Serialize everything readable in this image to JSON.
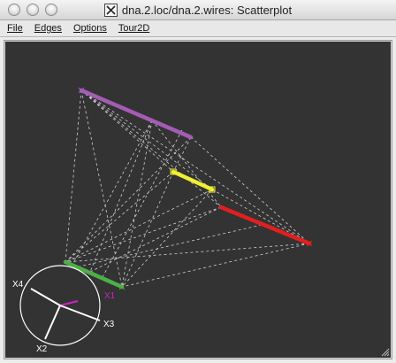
{
  "window": {
    "title": "dna.2.loc/dna.2.wires: Scatterplot",
    "title_icon": "x11-icon"
  },
  "menu": {
    "items": [
      {
        "key": "file",
        "label": "File"
      },
      {
        "key": "edges",
        "label": "Edges"
      },
      {
        "key": "options",
        "label": "Options"
      },
      {
        "key": "tour2d",
        "label": "Tour2D"
      }
    ]
  },
  "plot": {
    "background": "#333333",
    "edge_color": "#cfcfcf",
    "axis_color": "#ffffff",
    "highlight_axis_color": "#cc22cc",
    "segment_colors": {
      "purple": "#a45cb4",
      "yellow": "#f0f030",
      "red": "#e02020",
      "green": "#4caf48"
    },
    "axis_labels": {
      "x1": "X1",
      "x2": "X2",
      "x3": "X3",
      "x4": "X4"
    }
  }
}
